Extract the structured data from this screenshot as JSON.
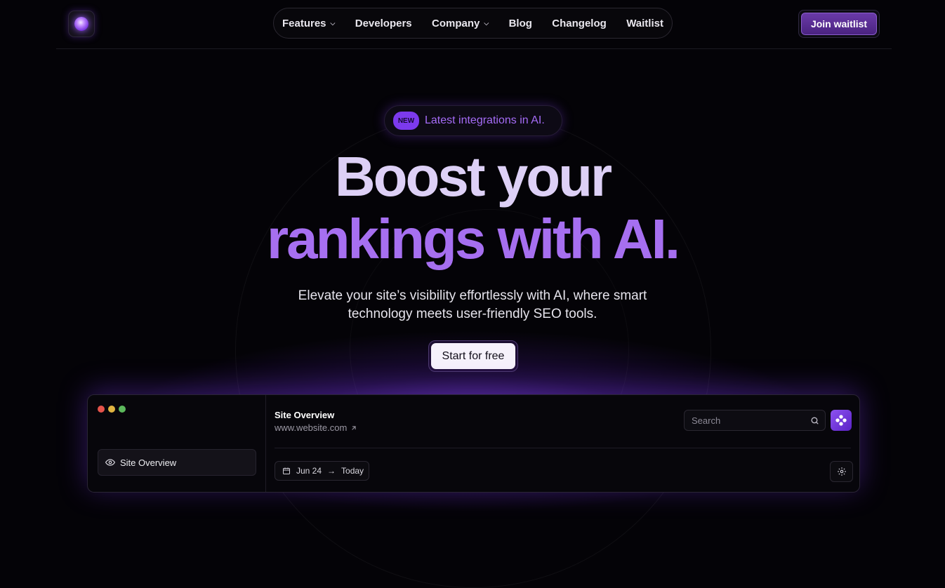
{
  "header": {
    "nav": [
      {
        "label": "Features",
        "has_dropdown": true
      },
      {
        "label": "Developers",
        "has_dropdown": false
      },
      {
        "label": "Company",
        "has_dropdown": true
      },
      {
        "label": "Blog",
        "has_dropdown": false
      },
      {
        "label": "Changelog",
        "has_dropdown": false
      },
      {
        "label": "Waitlist",
        "has_dropdown": false
      }
    ],
    "cta_label": "Join waitlist"
  },
  "hero": {
    "badge_tag": "NEW",
    "badge_text": "Latest integrations in AI.",
    "title_line1": "Boost your",
    "title_line2": "rankings with AI.",
    "subtitle_line1": "Elevate your site’s visibility effortlessly with AI, where smart",
    "subtitle_line2": "technology meets user-friendly SEO tools.",
    "primary_cta": "Start for free"
  },
  "app_preview": {
    "sidebar": {
      "active_item": "Site Overview"
    },
    "main": {
      "title": "Site Overview",
      "url": "www.website.com",
      "search_placeholder": "Search",
      "date_from": "Jun 24",
      "date_to": "Today"
    }
  },
  "colors": {
    "background": "#040307",
    "accent": "#a66ff0",
    "title_light": "#ddd0f6",
    "badge_pill": "#7c3aed"
  },
  "icons": [
    "chevron-down-icon",
    "eye-icon",
    "external-link-icon",
    "search-icon",
    "logo-icon",
    "calendar-icon",
    "arrow-right-icon",
    "settings-icon"
  ]
}
